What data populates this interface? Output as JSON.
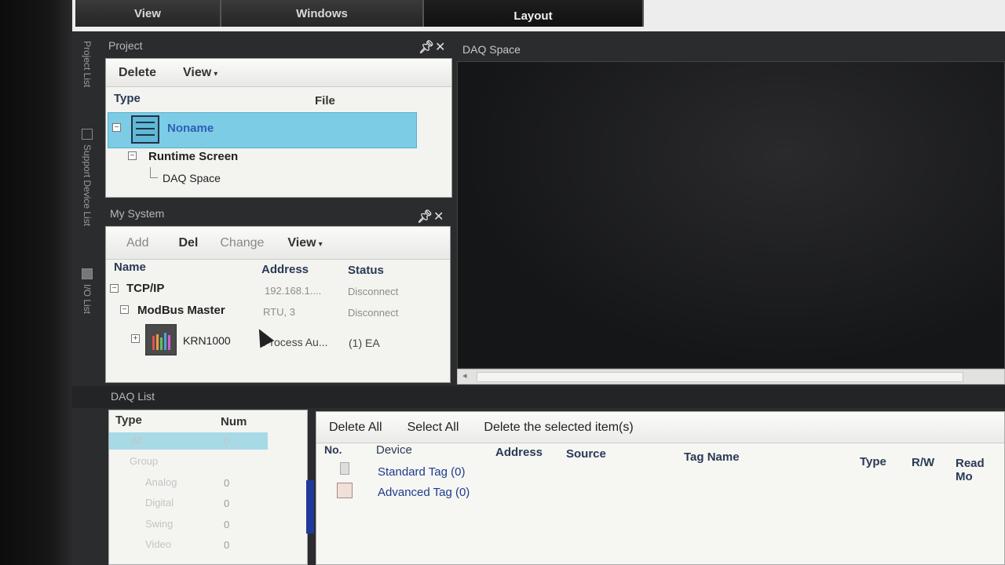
{
  "menu": {
    "tabs": [
      {
        "label": "View"
      },
      {
        "label": "Windows"
      },
      {
        "label": "Layout"
      }
    ]
  },
  "side_tabs": {
    "project_list": "Project List",
    "support_device_list": "Support Device List",
    "io_list": "I/O List"
  },
  "project": {
    "title": "Project",
    "toolbar": {
      "delete": "Delete",
      "view": "View"
    },
    "columns": {
      "type": "Type",
      "file": "File"
    },
    "tree": {
      "root": "Noname",
      "runtime_screen": "Runtime Screen",
      "daq_space": "DAQ Space"
    }
  },
  "my_system": {
    "title": "My System",
    "toolbar": {
      "add": "Add",
      "del": "Del",
      "change": "Change",
      "view": "View"
    },
    "columns": {
      "name": "Name",
      "address": "Address",
      "status": "Status"
    },
    "rows": [
      {
        "name": "TCP/IP",
        "address": "192.168.1....",
        "status": "Disconnect"
      },
      {
        "name": "ModBus Master",
        "address": "RTU, 3",
        "status": "Disconnect"
      },
      {
        "name": "KRN1000",
        "address": "Process Au...",
        "status": "(1) EA"
      }
    ]
  },
  "daq_space": {
    "title": "DAQ Space"
  },
  "daq_list": {
    "title": "DAQ List",
    "left": {
      "columns": {
        "type": "Type",
        "num": "Num"
      },
      "rows": [
        {
          "type": "All",
          "num": "0"
        },
        {
          "type": "Group",
          "num": ""
        },
        {
          "type": "Analog",
          "num": "0"
        },
        {
          "type": "Digital",
          "num": "0"
        },
        {
          "type": "Swing",
          "num": "0"
        },
        {
          "type": "Video",
          "num": "0"
        }
      ]
    },
    "toolbar": {
      "delete_all": "Delete All",
      "select_all": "Select All",
      "delete_selected": "Delete the selected item(s)"
    },
    "columns": {
      "no": "No.",
      "device": "Device",
      "address": "Address",
      "source": "Source",
      "tag_name": "Tag Name",
      "type": "Type",
      "rw": "R/W",
      "read_mode": "Read Mo"
    },
    "tags": [
      {
        "label": "Standard Tag (0)"
      },
      {
        "label": "Advanced Tag (0)"
      }
    ]
  }
}
